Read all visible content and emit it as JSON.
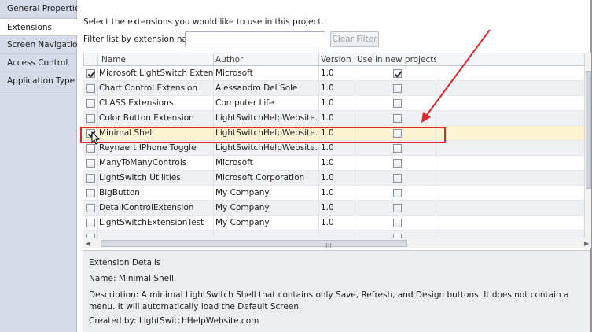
{
  "sidebar": {
    "tabs": [
      {
        "label": "General Properties",
        "active": false
      },
      {
        "label": "Extensions",
        "active": true
      },
      {
        "label": "Screen Navigation",
        "active": false
      },
      {
        "label": "Access Control",
        "active": false
      },
      {
        "label": "Application Type",
        "active": false
      }
    ]
  },
  "main": {
    "instructions": "Select the extensions you would like to use in this project.",
    "filter_label": "Filter list by extension name:",
    "filter_value": "",
    "clear_button": "Clear Filter"
  },
  "grid": {
    "headers": [
      "Name",
      "Author",
      "Version",
      "Use in new projects"
    ],
    "rows": [
      {
        "enabled": true,
        "name": "Microsoft LightSwitch Extensions",
        "author": "Microsoft",
        "version": "1.0",
        "use_new": true
      },
      {
        "enabled": false,
        "name": "Chart Control Extension",
        "author": "Alessandro Del Sole",
        "version": "1.0",
        "use_new": false
      },
      {
        "enabled": false,
        "name": "CLASS Extensions",
        "author": "Computer Life",
        "version": "1.0",
        "use_new": false
      },
      {
        "enabled": false,
        "name": "Color Button Extension",
        "author": "LightSwitchHelpWebsite.com",
        "version": "1.0",
        "use_new": false
      },
      {
        "enabled": true,
        "name": "Minimal Shell",
        "author": "LightSwitchHelpWebsite.com",
        "version": "1.0",
        "use_new": false,
        "selected": true
      },
      {
        "enabled": false,
        "name": "Reynaert IPhone Toggle",
        "author": "LightSwitchHelpWebsite.com",
        "version": "1.0",
        "use_new": false
      },
      {
        "enabled": false,
        "name": "ManyToManyControls",
        "author": "Microsoft",
        "version": "1.0",
        "use_new": false
      },
      {
        "enabled": false,
        "name": "LightSwitch Utilities",
        "author": "Microsoft Corporation",
        "version": "1.0",
        "use_new": false
      },
      {
        "enabled": false,
        "name": "BigButton",
        "author": "My Company",
        "version": "1.0",
        "use_new": false
      },
      {
        "enabled": false,
        "name": "DetailControlExtension",
        "author": "My Company",
        "version": "1.0",
        "use_new": false
      },
      {
        "enabled": false,
        "name": "LightSwitchExtensionTest",
        "author": "My Company",
        "version": "1.0",
        "use_new": false
      },
      {
        "enabled": false,
        "name": "",
        "author": "",
        "version": "",
        "use_new": false
      }
    ]
  },
  "details": {
    "title": "Extension Details",
    "name": "Name: Minimal Shell",
    "description": "Description: A minimal LightSwitch Shell that contains only Save, Refresh, and Design buttons. It does not contain a menu. It will automatically load the Default Screen.",
    "created_by": "Created by: LightSwitchHelpWebsite.com"
  },
  "colors": {
    "highlight": "#e0262d",
    "selected_row": "#fcf3d3",
    "sidebar": "#d6dbe9"
  }
}
